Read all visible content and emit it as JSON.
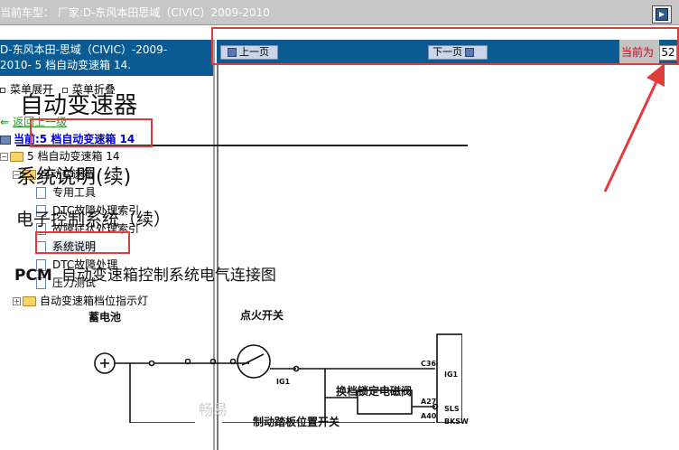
{
  "topbar": {
    "title": "当前车型：  厂家:D-东风本田思域（CIVIC）2009-2010"
  },
  "left_panel": {
    "header_line1": "D-东风本田-思域（CIVIC）-2009-",
    "header_line2": "2010- 5 档自动变速箱 14.",
    "expand_all": "菜单展开",
    "collapse_all": "菜单折叠",
    "back_label": "返回上一级",
    "current_label": "当前:5 档自动变速箱 14",
    "tree": {
      "root": "5 档自动变速箱 14",
      "group": "自动变速箱",
      "leaves": [
        "专用工具",
        "DTC故障处理索引",
        "故障症状处理索引",
        "系统说明",
        "DTC故障处理",
        "压力测试"
      ],
      "group2": "自动变速箱档位指示灯"
    }
  },
  "nav": {
    "prev_label": "上一页",
    "next_label": "下一页",
    "current_page_label": "当前为",
    "current_page_value": "52"
  },
  "document": {
    "title": "自动变速器",
    "section": "系统说明(续)",
    "subsection": "电子控制系统（续）",
    "figure_title_bold": "PCM",
    "figure_title": "自动变速箱控制系统电气连接图"
  },
  "circuit": {
    "battery": "蓄电池",
    "ignition": "点火开关",
    "solenoid": "换档锁定电磁阀",
    "brake": "制动踏板位置开关",
    "ig1": "IG1",
    "c36": "C36",
    "a27": "A27",
    "a40": "A40",
    "pin_ig1": "IG1",
    "pin_sls": "SLS",
    "pin_bksw": "BKSW"
  },
  "watermark": "畅易",
  "colors": {
    "accent": "#0a5b91",
    "annotation": "#e23b3b"
  }
}
